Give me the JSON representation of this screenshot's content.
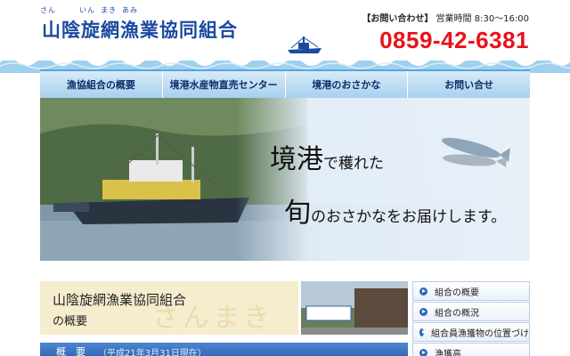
{
  "header": {
    "ruby": [
      "さん",
      "いん",
      "まき",
      "あみ"
    ],
    "title": "山陰旋網漁業協同組合",
    "contact_label": "【お問い合わせ】",
    "hours": "営業時間 8:30〜16:00",
    "phone": "0859-42-6381"
  },
  "nav": {
    "items": [
      {
        "label": "漁協組合の概要"
      },
      {
        "label": "境港水産物直売センター"
      },
      {
        "label": "境港のおさかな"
      },
      {
        "label": "お問い合せ"
      }
    ]
  },
  "hero": {
    "line1_big": "境港",
    "line1_small": "で穫れた",
    "line2_big": "旬",
    "line2_small": "のおさかなをお届けします。"
  },
  "intro": {
    "name": "山陰旋網漁業協同組合",
    "sub": "の概要",
    "watermark": "さんまき"
  },
  "section": {
    "title": "概　要",
    "sub": "（平成21年3月31日現在）"
  },
  "side_menu": {
    "items": [
      {
        "label": "組合の概要"
      },
      {
        "label": "組合の概況"
      },
      {
        "label": "組合員漁獲物の位置づけ"
      },
      {
        "label": "漁獲高"
      }
    ]
  },
  "colors": {
    "brand_blue": "#1b4aa1",
    "phone_red": "#e8121b",
    "nav_bg": "#a9d0ee"
  }
}
